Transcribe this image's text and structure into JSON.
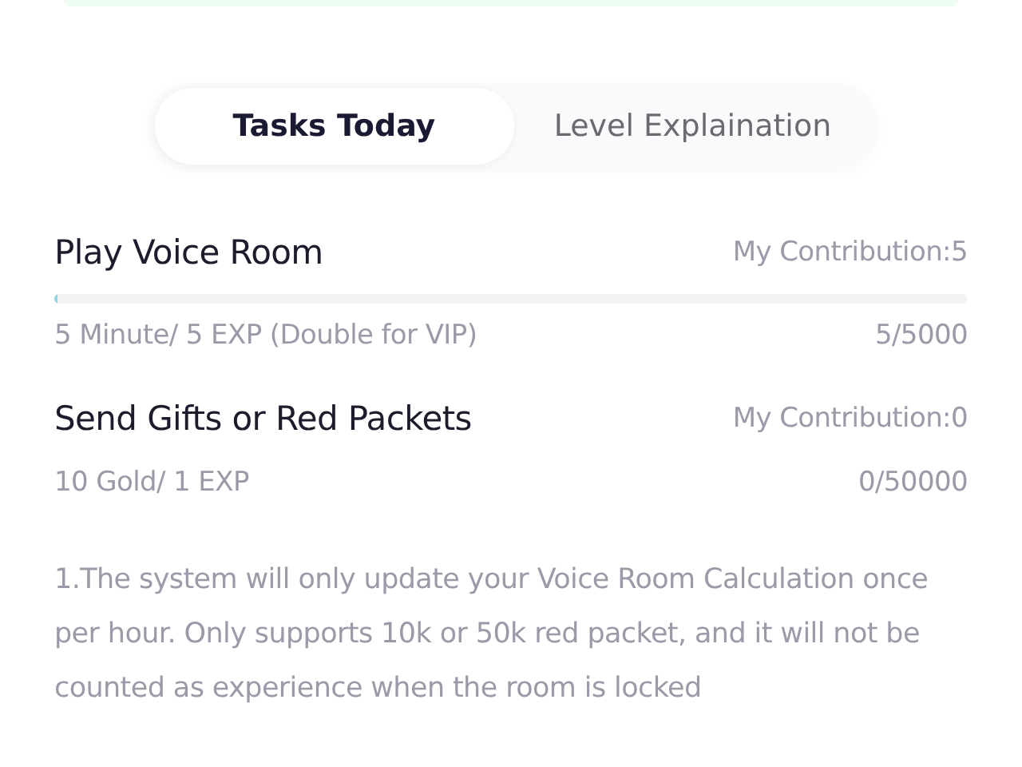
{
  "tabs": [
    {
      "label": "Tasks Today",
      "selected": true
    },
    {
      "label": "Level Explaination",
      "selected": false
    }
  ],
  "tasks": [
    {
      "title": "Play Voice Room",
      "contribution": "My Contribution:5",
      "level": 0.003,
      "rule": "5 Minute/ 5 EXP (Double for VIP)",
      "progress": "5/5000"
    },
    {
      "title": "Send Gifts or Red Packets",
      "contribution": "My Contribution:0",
      "rule": "10 Gold/ 1 EXP",
      "progress": "0/50000"
    }
  ],
  "notes": [
    "1.The system will only update your Voice Room Calculation once per hour. Only supports 10k or 50k red packet, and it will not be counted as experience when the room is locked"
  ]
}
